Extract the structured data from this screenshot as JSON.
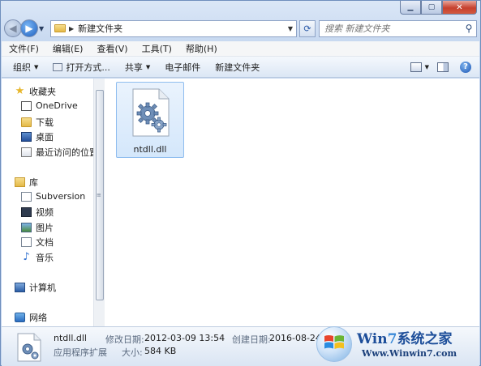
{
  "window": {
    "caption_buttons": {
      "minimize": "▁",
      "maximize": "▢",
      "close": "✕"
    }
  },
  "address": {
    "path": "新建文件夹",
    "search_placeholder": "搜索 新建文件夹"
  },
  "menu": [
    "文件(F)",
    "编辑(E)",
    "查看(V)",
    "工具(T)",
    "帮助(H)"
  ],
  "toolbar": {
    "organize": "组织",
    "open_with": "打开方式...",
    "share": "共享",
    "email": "电子邮件",
    "new_folder": "新建文件夹"
  },
  "nav": {
    "favorites": "收藏夹",
    "onedrive": "OneDrive",
    "downloads": "下载",
    "desktop": "桌面",
    "recent": "最近访问的位置",
    "libraries": "库",
    "subversion": "Subversion",
    "videos": "视频",
    "pictures": "图片",
    "documents": "文档",
    "music": "音乐",
    "computer": "计算机",
    "network": "网络"
  },
  "files": [
    {
      "name": "ntdll.dll",
      "icon": "dll-gear-icon"
    }
  ],
  "details": {
    "name": "ntdll.dll",
    "type": "应用程序扩展",
    "modified_label": "修改日期:",
    "modified_value": "2012-03-09 13:54",
    "created_label": "创建日期:",
    "created_value": "2016-08-24 11:2",
    "size_label": "大小:",
    "size_value": "584 KB"
  },
  "watermark": {
    "brand_w": "Win",
    "brand_7": "7",
    "brand_cn": "系统之家",
    "url": "Www.Winwin7.com"
  }
}
